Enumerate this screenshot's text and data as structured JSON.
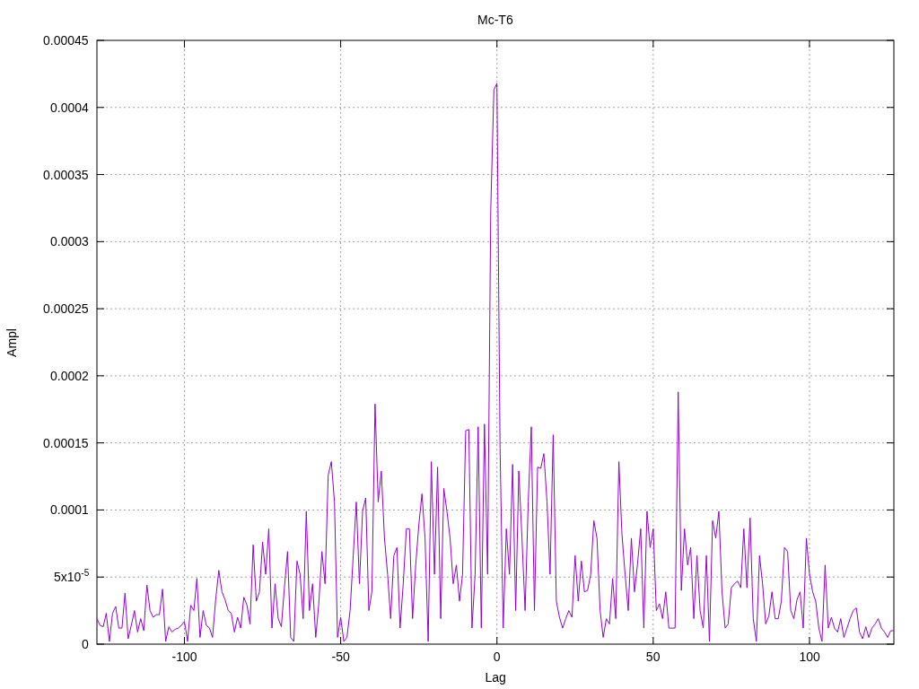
{
  "chart_data": {
    "type": "line",
    "title": "Mc-T6",
    "xlabel": "Lag",
    "ylabel": "Ampl",
    "xlim": [
      -128,
      127
    ],
    "ylim": [
      0,
      0.00045
    ],
    "grid": true,
    "xticks": [
      -100,
      -50,
      0,
      50,
      100
    ],
    "yticks": [
      0,
      {
        "value": 5e-05,
        "label": "5x10$^{-5}$"
      },
      0.0001,
      0.00015,
      0.0002,
      0.00025,
      0.0003,
      0.00035,
      0.0004,
      0.00045
    ],
    "x": [
      -128,
      -127,
      -126,
      -125,
      -124,
      -123,
      -122,
      -121,
      -120,
      -119,
      -118,
      -117,
      -116,
      -115,
      -114,
      -113,
      -112,
      -111,
      -110,
      -109,
      -108,
      -107,
      -106,
      -105,
      -104,
      -103,
      -102,
      -101,
      -100,
      -99,
      -98,
      -97,
      -96,
      -95,
      -94,
      -93,
      -92,
      -91,
      -90,
      -89,
      -88,
      -87,
      -86,
      -85,
      -84,
      -83,
      -82,
      -81,
      -80,
      -79,
      -78,
      -77,
      -76,
      -75,
      -74,
      -73,
      -72,
      -71,
      -70,
      -69,
      -68,
      -67,
      -66,
      -65,
      -64,
      -63,
      -62,
      -61,
      -60,
      -59,
      -58,
      -57,
      -56,
      -55,
      -54,
      -53,
      -52,
      -51,
      -50,
      -49,
      -48,
      -47,
      -46,
      -45,
      -44,
      -43,
      -42,
      -41,
      -40,
      -39,
      -38,
      -37,
      -36,
      -35,
      -34,
      -33,
      -32,
      -31,
      -30,
      -29,
      -28,
      -27,
      -26,
      -25,
      -24,
      -23,
      -22,
      -21,
      -20,
      -19,
      -18,
      -17,
      -16,
      -15,
      -14,
      -13,
      -12,
      -11,
      -10,
      -9,
      -8,
      -7,
      -6,
      -5,
      -4,
      -3,
      -2,
      -1,
      0,
      1,
      2,
      3,
      4,
      5,
      6,
      7,
      8,
      9,
      10,
      11,
      12,
      13,
      14,
      15,
      16,
      17,
      18,
      19,
      20,
      21,
      22,
      23,
      24,
      25,
      26,
      27,
      28,
      29,
      30,
      31,
      32,
      33,
      34,
      35,
      36,
      37,
      38,
      39,
      40,
      41,
      42,
      43,
      44,
      45,
      46,
      47,
      48,
      49,
      50,
      51,
      52,
      53,
      54,
      55,
      56,
      57,
      58,
      59,
      60,
      61,
      62,
      63,
      64,
      65,
      66,
      67,
      68,
      69,
      70,
      71,
      72,
      73,
      74,
      75,
      76,
      77,
      78,
      79,
      80,
      81,
      82,
      83,
      84,
      85,
      86,
      87,
      88,
      89,
      90,
      91,
      92,
      93,
      94,
      95,
      96,
      97,
      98,
      99,
      100,
      101,
      102,
      103,
      104,
      105,
      106,
      107,
      108,
      109,
      110,
      111,
      112,
      113,
      114,
      115,
      116,
      117,
      118,
      119,
      120,
      121,
      122,
      123,
      124,
      125,
      126,
      127
    ],
    "series": [
      {
        "color": "#9400d3",
        "values": [
          1.9e-05,
          1.4e-05,
          1.3e-05,
          2.3e-05,
          2e-06,
          2.3e-05,
          2.8e-05,
          1.2e-05,
          1.2e-05,
          3.8e-05,
          4e-06,
          1.4e-05,
          2.5e-05,
          9e-06,
          1.9e-05,
          1e-05,
          4.4e-05,
          2.5e-05,
          2e-05,
          2.2e-05,
          2.2e-05,
          4.1e-05,
          2e-06,
          1.3e-05,
          9e-06,
          1.1e-05,
          1.2e-05,
          1.4e-05,
          1.7e-05,
          2e-06,
          2.9e-05,
          2.5e-05,
          4.9e-05,
          5e-06,
          2.5e-05,
          1.4e-05,
          1.2e-05,
          5e-06,
          3.3e-05,
          5.5e-05,
          3.9e-05,
          3.3e-05,
          2.5e-05,
          2.3e-05,
          9e-06,
          2e-05,
          1.2e-05,
          3.5e-05,
          2.9e-05,
          1.5e-05,
          7.4e-05,
          3.2e-05,
          3.9e-05,
          7.6e-05,
          5.2e-05,
          8.6e-05,
          1.2e-05,
          4.5e-05,
          1.9e-05,
          1.3e-05,
          4.2e-05,
          6.9e-05,
          5e-06,
          2e-06,
          6.2e-05,
          5.2e-05,
          1.9e-05,
          9.9e-05,
          2.5e-05,
          4.5e-05,
          5e-06,
          3e-05,
          6.9e-05,
          4.5e-05,
          0.000126,
          0.000136,
          0.000106,
          5e-06,
          2e-05,
          2e-06,
          5e-06,
          2.5e-05,
          6.6e-05,
          0.000106,
          4.5e-05,
          9.9e-05,
          0.000109,
          2.5e-05,
          3.9e-05,
          0.000179,
          0.000106,
          0.000129,
          7.9e-05,
          5.2e-05,
          1.9e-05,
          6.6e-05,
          7.2e-05,
          1.2e-05,
          4.5e-05,
          8.6e-05,
          8.6e-05,
          1.9e-05,
          5.9e-05,
          8.9e-05,
          0.000112,
          7.9e-05,
          2e-06,
          0.000136,
          5.2e-05,
          0.000132,
          1.9e-05,
          0.000116,
          9.9e-05,
          7.9e-05,
          4.5e-05,
          5.9e-05,
          3.2e-05,
          5.2e-05,
          0.000159,
          0.00016,
          1.2e-05,
          5.2e-05,
          0.000162,
          1.2e-05,
          0.000164,
          5.2e-05,
          0.000323,
          0.000413,
          0.000418,
          0.000146,
          1.2e-05,
          8.6e-05,
          5.2e-05,
          0.000134,
          2.5e-05,
          0.000129,
          7.9e-05,
          2.5e-05,
          0.000106,
          0.000162,
          2.5e-05,
          0.000132,
          0.000131,
          0.000142,
          0.000106,
          5.2e-05,
          0.000156,
          3.2e-05,
          2e-05,
          1.2e-05,
          1.9e-05,
          2.5e-05,
          2e-05,
          6.6e-05,
          3.2e-05,
          6.2e-05,
          3.9e-05,
          4e-05,
          5.2e-05,
          9.2e-05,
          7.9e-05,
          2.5e-05,
          5e-06,
          1.9e-05,
          1.5e-05,
          4.9e-05,
          1.9e-05,
          0.000136,
          8.2e-05,
          5.2e-05,
          2.5e-05,
          7.9e-05,
          3.9e-05,
          6e-05,
          8.6e-05,
          1.2e-05,
          9.9e-05,
          7.2e-05,
          8.6e-05,
          2.5e-05,
          3e-05,
          1.9e-05,
          3.9e-05,
          1.2e-05,
          1.2e-05,
          1.2e-05,
          0.000188,
          4e-05,
          8.6e-05,
          5.9e-05,
          7.2e-05,
          1.9e-05,
          6.6e-05,
          2.5e-05,
          1.2e-05,
          6.6e-05,
          2e-06,
          9.2e-05,
          7.9e-05,
          9.9e-05,
          3.9e-05,
          1.2e-05,
          1.5e-05,
          4.2e-05,
          4.5e-05,
          4.7e-05,
          4.2e-05,
          8.6e-05,
          4.2e-05,
          9.4e-05,
          1.9e-05,
          2e-06,
          6.6e-05,
          4.5e-05,
          1.5e-05,
          2.1e-05,
          3.9e-05,
          1.9e-05,
          1.9e-05,
          3.2e-05,
          7.2e-05,
          6.9e-05,
          2.5e-05,
          1.9e-05,
          3.3e-05,
          3.9e-05,
          1.2e-05,
          7.9e-05,
          5.2e-05,
          3.9e-05,
          3.2e-05,
          1.2e-05,
          2e-06,
          5.9e-05,
          1.2e-05,
          2e-05,
          1.2e-05,
          9e-06,
          1.9e-05,
          5e-06,
          1.2e-05,
          1.9e-05,
          2.5e-05,
          2.7e-05,
          9e-06,
          4e-06,
          1.3e-05,
          5e-06,
          1.2e-05,
          1.5e-05,
          1.9e-05,
          1.2e-05,
          9e-06,
          5e-06,
          1e-05,
          1e-05
        ]
      }
    ]
  }
}
